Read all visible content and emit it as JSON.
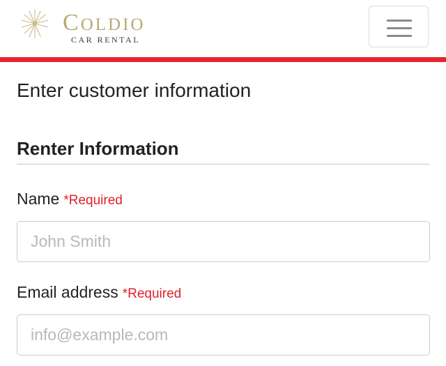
{
  "header": {
    "brand_initial": "C",
    "brand_rest": "OLDIO",
    "brand_subtitle": "CAR RENTAL",
    "logo_icon": "sunburst-crescent-logo",
    "menu_icon": "hamburger-menu-icon"
  },
  "colors": {
    "accent_red": "#e8232f",
    "brand_gold": "#b8a874",
    "required_red": "#e0202a"
  },
  "page": {
    "title": "Enter customer information"
  },
  "renter_section": {
    "title": "Renter Information",
    "fields": [
      {
        "label": "Name",
        "required_text": "*Required",
        "value": "",
        "placeholder": "John Smith"
      },
      {
        "label": "Email address",
        "required_text": "*Required",
        "value": "",
        "placeholder": "info@example.com"
      }
    ]
  }
}
